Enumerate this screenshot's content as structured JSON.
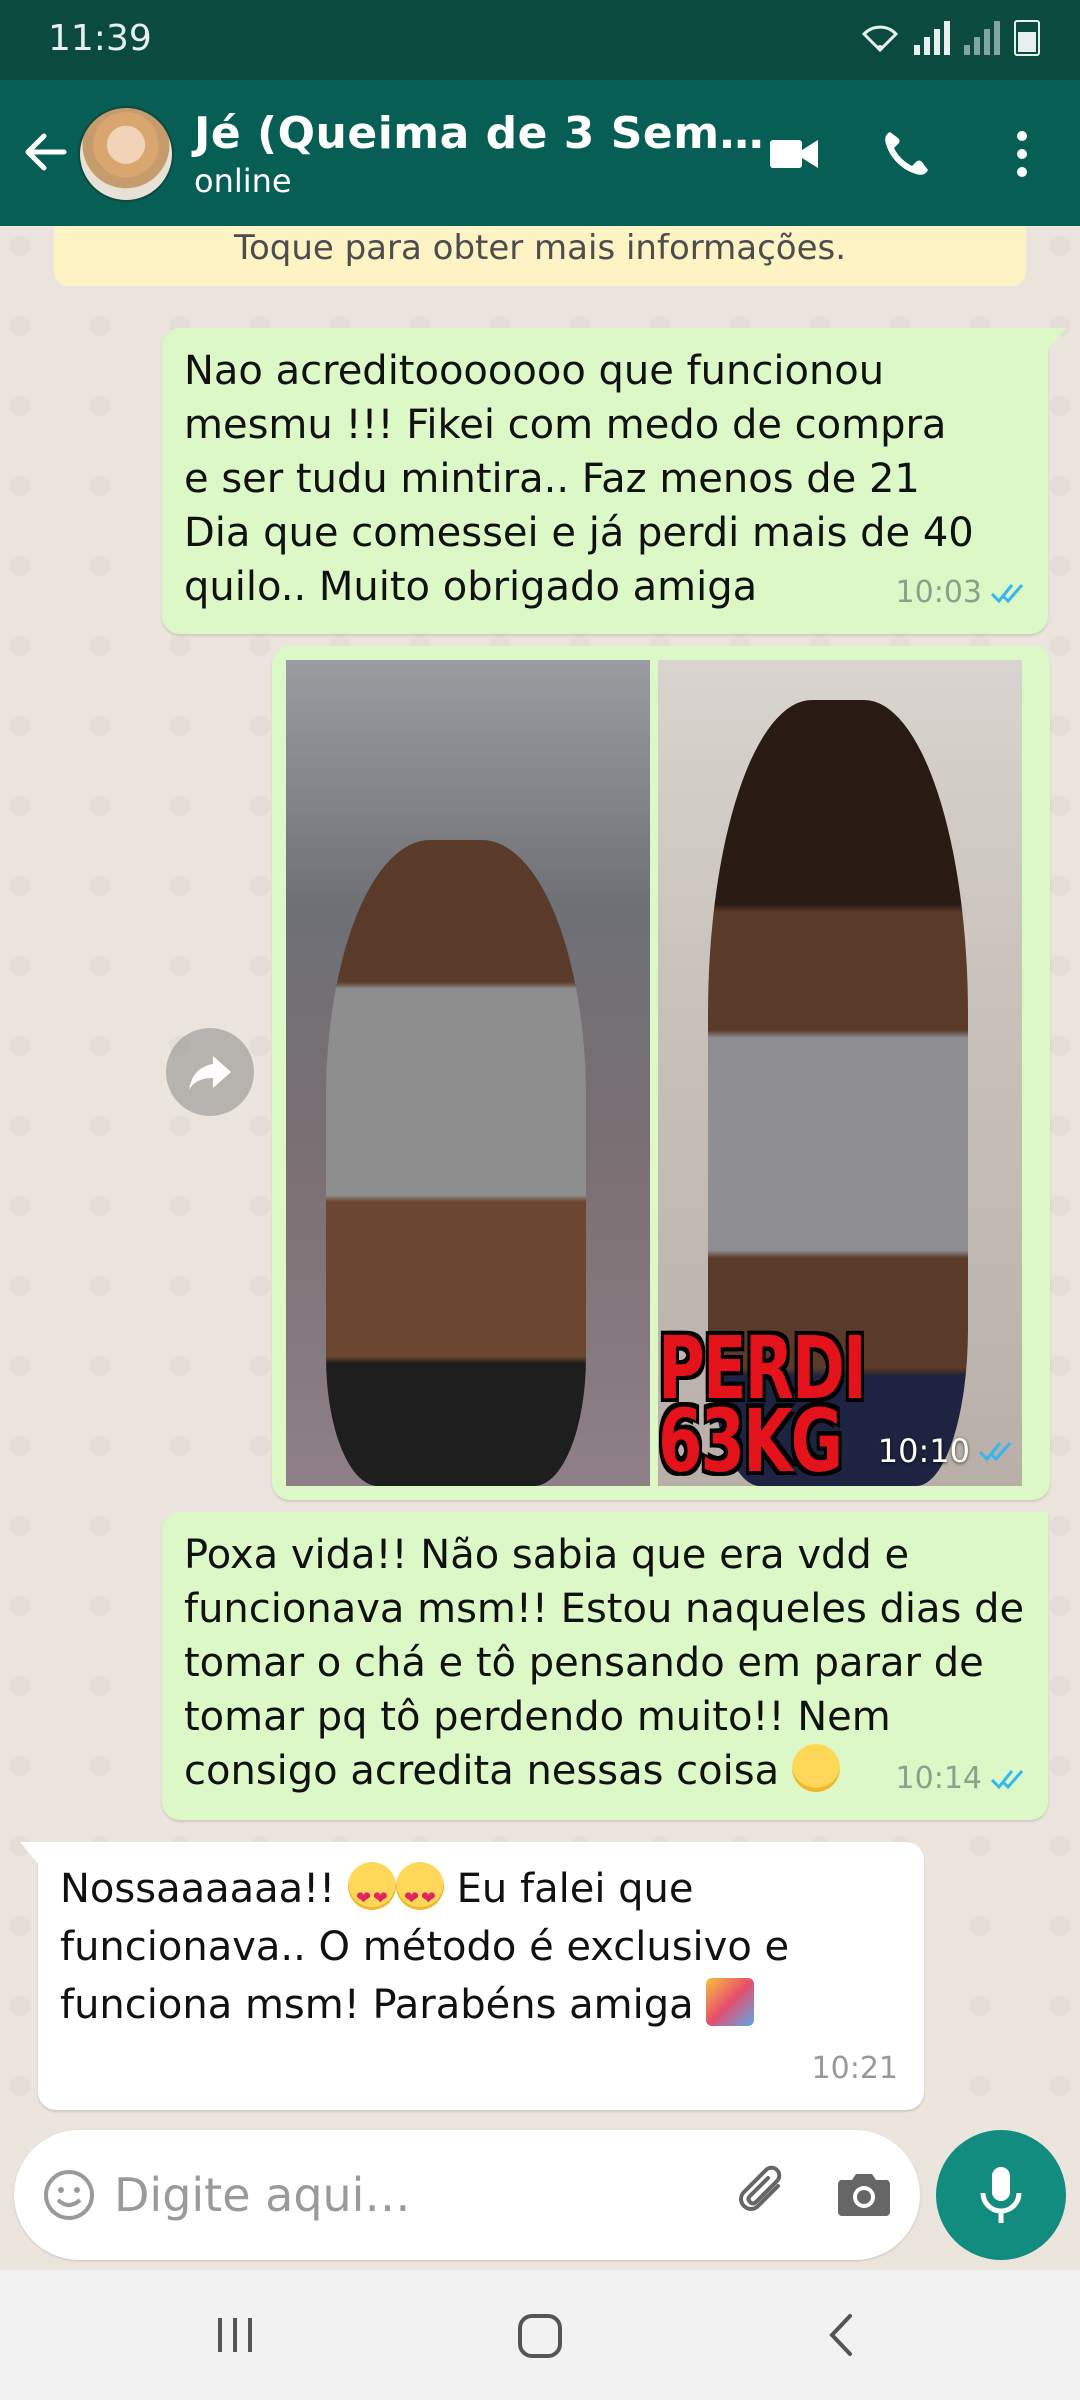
{
  "status_bar": {
    "time": "11:39"
  },
  "header": {
    "contact_name": "Jé (Queima de 3 Sem…",
    "contact_status": "online"
  },
  "chat": {
    "info_banner": "Toque para obter mais informações.",
    "messages": [
      {
        "direction": "outgoing",
        "text": "Nao acreditooooooo que funcionou mesmu !!! Fikei com medo de compra e ser tudu mintira.. Faz menos de 21 Dia que comessei e já perdi mais de 40 quilo.. Muito obrigado amiga",
        "time": "10:03",
        "status": "read"
      },
      {
        "direction": "outgoing",
        "type": "image",
        "image_overlay_text": "PERDI 63KG",
        "time": "10:10",
        "status": "read"
      },
      {
        "direction": "outgoing",
        "text": "Poxa vida!! Não sabia que era vdd e funcionava msm!! Estou naqueles dias de tomar o chá e tô pensando em parar de tomar pq tô perdendo muito!! Nem consigo acredita nessas coisa",
        "emoji": "face-with-tears-of-joy",
        "time": "10:14",
        "status": "read"
      },
      {
        "direction": "incoming",
        "text_part1": "Nossaaaaaa!!",
        "text_part2": "Eu falei que funcionava.. O método é exclusivo e funciona msm! Parabéns amiga",
        "emoji": [
          "smiling-face-with-heart-eyes",
          "smiling-face-with-heart-eyes",
          "party-popper"
        ],
        "time": "10:21"
      }
    ]
  },
  "input": {
    "placeholder": "Digite aqui…"
  },
  "colors": {
    "header": "#075e54",
    "status_bar": "#0a4a3f",
    "outgoing_bubble": "#dcf8c6",
    "incoming_bubble": "#ffffff",
    "read_tick": "#34b7f1",
    "mic_button": "#128c7e"
  }
}
